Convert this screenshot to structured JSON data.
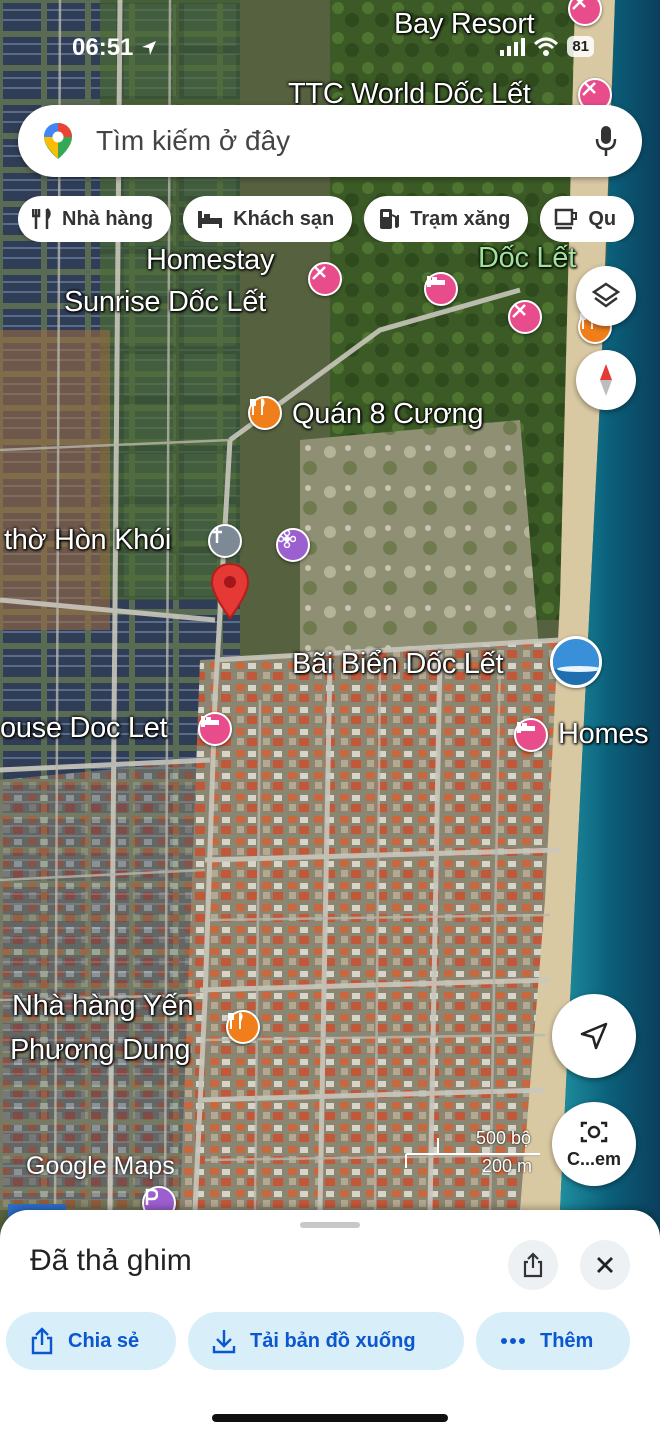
{
  "status_bar": {
    "time": "06:51",
    "battery": "81"
  },
  "search": {
    "placeholder": "Tìm kiếm ở đây"
  },
  "chips": [
    {
      "label": "Nhà hàng",
      "icon": "fork-knife-icon"
    },
    {
      "label": "Khách sạn",
      "icon": "bed-icon"
    },
    {
      "label": "Trạm xăng",
      "icon": "fuel-icon"
    },
    {
      "label": "Qu",
      "icon": "cafe-icon"
    }
  ],
  "map_labels": {
    "bay_resort": "Bay Resort",
    "ttc_world": "TTC World Dốc Lết",
    "doc_let_green": "Dốc Lết",
    "homestay_sunrise_1": "Homestay",
    "homestay_sunrise_2": "Sunrise Dốc Lết",
    "quan_8_cuong": "Quán 8 Cương",
    "tho_hon_khoi": "thờ Hòn Khói",
    "bai_bien": "Bãi Biển Dốc Lết",
    "house_doc_let": "ouse Doc Let",
    "homes": "Homes",
    "nha_hang_yen_1": "Nhà hàng Yến",
    "nha_hang_yen_2": "Phương Dung"
  },
  "map_ui": {
    "logo": "Google Maps",
    "scale_top": "500 bộ",
    "scale_bottom": "200 m",
    "lens_label": "C...em"
  },
  "sheet": {
    "title": "Đã thả ghim",
    "actions": [
      {
        "label": "Chia sẻ",
        "icon": "share-icon"
      },
      {
        "label": "Tải bản đồ xuống",
        "icon": "download-icon"
      },
      {
        "label": "Thêm",
        "icon": "more-icon"
      }
    ]
  },
  "colors": {
    "accent": "#0b57d0",
    "pin": "#e53935",
    "chip_bg": "#d8eef9"
  }
}
